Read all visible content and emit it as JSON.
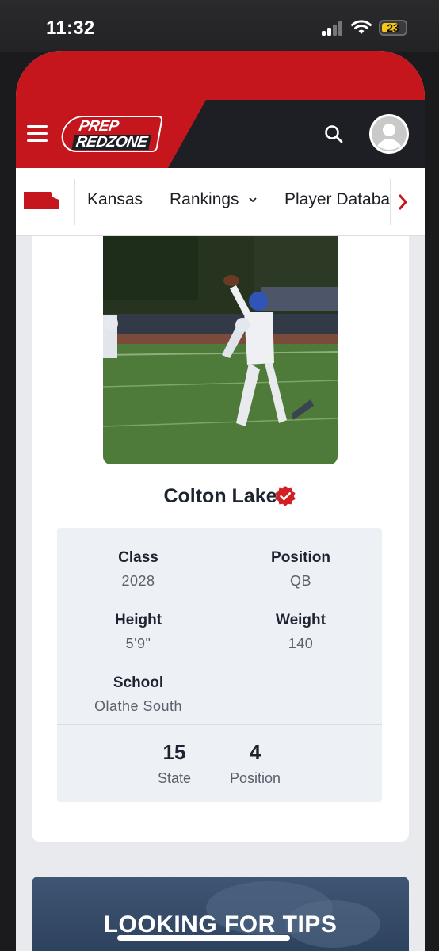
{
  "status_bar": {
    "time": "11:32",
    "battery": "23"
  },
  "nav": {
    "state": "Kansas",
    "rankings": "Rankings",
    "player_database": "Player Databa"
  },
  "logo": {
    "line1": "PREP",
    "line2": "REDZONE"
  },
  "player": {
    "name": "Colton Lake",
    "class_label": "Class",
    "class_value": "2028",
    "position_label": "Position",
    "position_value": "QB",
    "height_label": "Height",
    "height_value": "5'9\"",
    "weight_label": "Weight",
    "weight_value": "140",
    "school_label": "School",
    "school_value": "Olathe South",
    "state_rank": "15",
    "state_rank_label": "State",
    "position_rank": "4",
    "position_rank_label": "Position"
  },
  "promo": {
    "title": "LOOKING FOR TIPS"
  },
  "colors": {
    "brand_red": "#c4161c",
    "header_dark": "#1d1f24",
    "battery": "#f5c518"
  }
}
